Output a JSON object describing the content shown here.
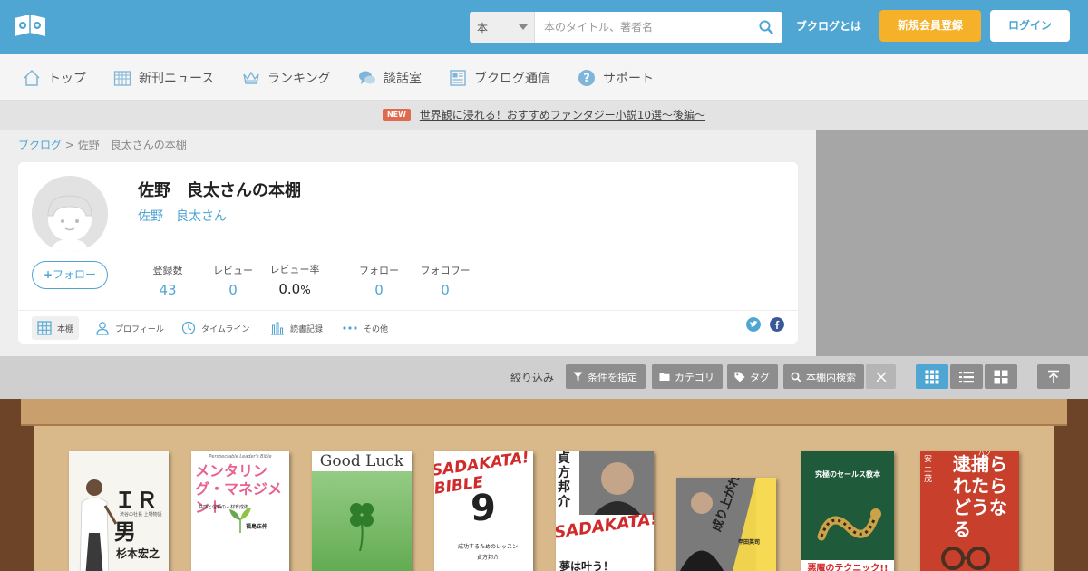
{
  "header": {
    "search_category": "本",
    "search_placeholder": "本のタイトル、著者名",
    "about_link": "ブクログとは",
    "signup_label": "新規会員登録",
    "login_label": "ログイン",
    "brand_color": "#4fa6d3",
    "accent_color": "#f5b12a"
  },
  "nav": {
    "items": [
      {
        "label": "トップ",
        "icon": "house-icon"
      },
      {
        "label": "新刊ニュース",
        "icon": "calendar-icon"
      },
      {
        "label": "ランキング",
        "icon": "crown-icon"
      },
      {
        "label": "談話室",
        "icon": "chat-icon"
      },
      {
        "label": "ブクログ通信",
        "icon": "newspaper-icon"
      },
      {
        "label": "サポート",
        "icon": "help-icon"
      }
    ]
  },
  "news": {
    "badge": "NEW",
    "text": "世界観に浸れる！おすすめファンタジー小説10選〜後編〜"
  },
  "breadcrumb": {
    "root": "ブクログ",
    "separator": ">",
    "current": "佐野　良太さんの本棚"
  },
  "profile": {
    "shelf_title": "佐野　良太さんの本棚",
    "user_name": "佐野　良太さん",
    "follow_label": "フォロー",
    "stats": [
      {
        "label": "登録数",
        "value": "43"
      },
      {
        "label": "レビュー",
        "value": "0"
      },
      {
        "label": "レビュー率",
        "value": "0.0",
        "unit": "%"
      },
      {
        "label": "フォロー",
        "value": "0"
      },
      {
        "label": "フォロワー",
        "value": "0"
      }
    ],
    "tabs": [
      {
        "label": "本棚",
        "icon": "grid-icon"
      },
      {
        "label": "プロフィール",
        "icon": "person-icon"
      },
      {
        "label": "タイムライン",
        "icon": "clock-icon"
      },
      {
        "label": "読書記録",
        "icon": "bar-chart-icon"
      },
      {
        "label": "その他",
        "icon": "more-icon"
      }
    ]
  },
  "filters": {
    "label": "絞り込み",
    "buttons": [
      {
        "label": "条件を指定",
        "icon": "filter-icon"
      },
      {
        "label": "カテゴリ",
        "icon": "folder-icon"
      },
      {
        "label": "タグ",
        "icon": "tag-icon"
      },
      {
        "label": "本棚内検索",
        "icon": "search-icon"
      }
    ]
  },
  "books": [
    {
      "title": "ＩＲ男",
      "author": "杉本宏之",
      "subtitle": "渋谷の社長 上場物語"
    },
    {
      "title": "メンタリング・マネジメント",
      "author": "福島正伸",
      "subtitle": "共感と信頼の人材育成術",
      "top_text": "Perspectable Leader's Bible"
    },
    {
      "title": "Good Luck"
    },
    {
      "title": "SADAKATA! BIBLE",
      "author": "貞方邦介",
      "subtitle": "成功するためのレッスン",
      "number": "9"
    },
    {
      "title": "SADAKATA!",
      "author": "貞方邦介",
      "subtitle": "夢は叶う！",
      "top_text": "貞方 邦介"
    },
    {
      "title": "成り上がれ!",
      "author": "甲田英司"
    },
    {
      "title": "悪魔のテクニック!!",
      "subtitle": "究極のセールス教本"
    },
    {
      "title": "逮捕られたらどうなる",
      "author": "安土茂",
      "ruby": "パク"
    }
  ]
}
